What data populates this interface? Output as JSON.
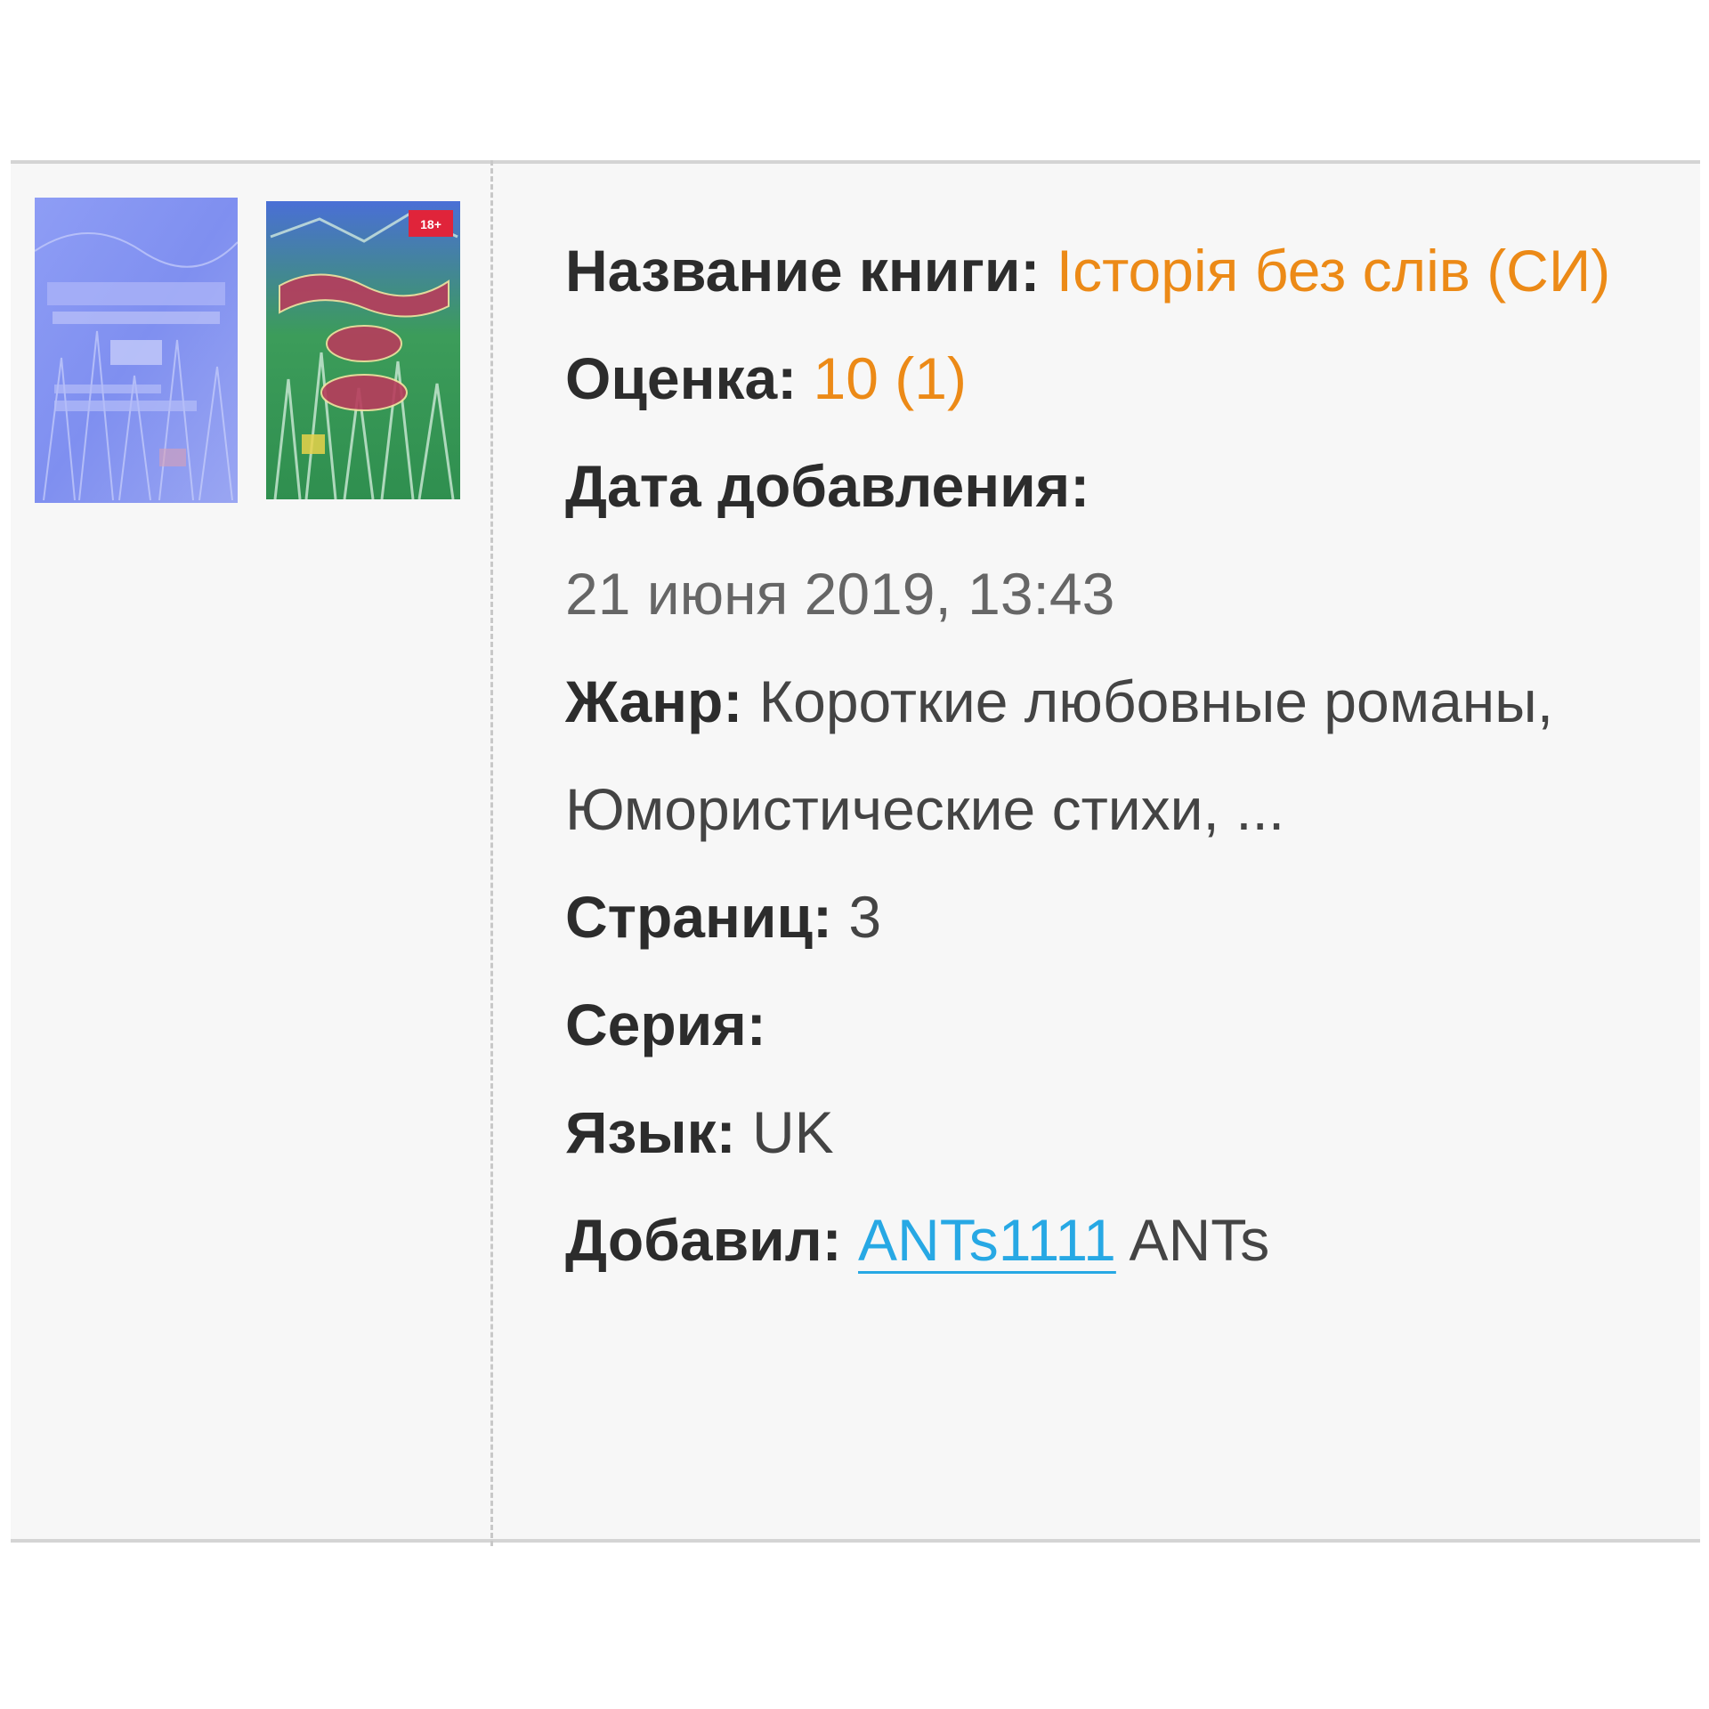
{
  "book": {
    "title_label": "Название книги:",
    "title_value": "Історія без слів (СИ)",
    "rating_label": "Оценка:",
    "rating_value": "10 (1)",
    "date_label": "Дата добавления:",
    "date_value": "21 июня 2019, 13:43",
    "genre_label": "Жанр:",
    "genre_value": "Короткие любовные романы, Юмористические стихи, ...",
    "pages_label": "Страниц:",
    "pages_value": "3",
    "series_label": "Серия:",
    "series_value": "",
    "language_label": "Язык:",
    "language_value": "UK",
    "added_by_label": "Добавил:",
    "added_by_link": "ANTs1111",
    "added_by_name": "ANTs"
  },
  "covers": {
    "badge": "18+"
  },
  "colors": {
    "accent": "#ec8a17",
    "link": "#27a8e4",
    "label": "#2c2c2c",
    "text": "#444444",
    "card_bg": "#f7f7f7"
  }
}
